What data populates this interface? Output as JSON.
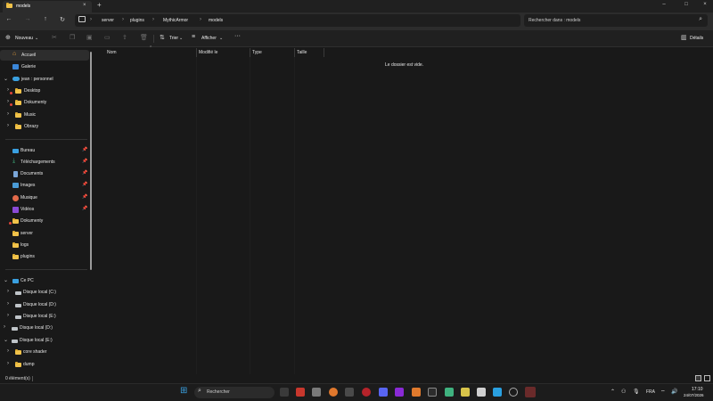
{
  "window": {
    "tab_title": "models",
    "new_tab": "+",
    "tab_close": "×",
    "minimize": "–",
    "maximize": "□",
    "close": "×"
  },
  "address": {
    "breadcrumbs": [
      "server",
      "plugins",
      "MythicArmor",
      "models"
    ],
    "search_placeholder": "Rechercher dans : models"
  },
  "toolbar": {
    "new_label": "Nouveau",
    "sort_label": "Trier",
    "view_label": "Afficher",
    "more_label": "···",
    "details_label": "Détails"
  },
  "sidebar": {
    "top": [
      {
        "label": "Accueil",
        "icon": "home-icon"
      },
      {
        "label": "Galerie",
        "icon": "gallery-icon"
      },
      {
        "label": "jean : personnel",
        "icon": "cloud-icon"
      },
      {
        "label": "Desktop",
        "icon": "folder-icon"
      },
      {
        "label": "Dokumenty",
        "icon": "folder-icon"
      },
      {
        "label": "Music",
        "icon": "folder-icon"
      },
      {
        "label": "Obrazy",
        "icon": "folder-icon"
      }
    ],
    "quick": [
      {
        "label": "Bureau",
        "icon": "desktop-icon"
      },
      {
        "label": "Téléchargements",
        "icon": "download-icon"
      },
      {
        "label": "Documents",
        "icon": "documents-icon"
      },
      {
        "label": "Images",
        "icon": "images-icon"
      },
      {
        "label": "Musique",
        "icon": "music-icon"
      },
      {
        "label": "Vidéos",
        "icon": "videos-icon"
      },
      {
        "label": "Dokumenty",
        "icon": "folder-icon"
      },
      {
        "label": "server",
        "icon": "folder-icon"
      },
      {
        "label": "logs",
        "icon": "folder-icon"
      },
      {
        "label": "plugins",
        "icon": "folder-icon"
      }
    ],
    "pc": [
      {
        "label": "Ce PC",
        "icon": "pc-icon"
      },
      {
        "label": "Disque local (C:)",
        "icon": "drive-icon"
      },
      {
        "label": "Disque local (D:)",
        "icon": "drive-icon"
      },
      {
        "label": "Disque local (E:)",
        "icon": "drive-icon"
      },
      {
        "label": "Disque local (D:)",
        "icon": "drive-icon"
      },
      {
        "label": "Disque local (E:)",
        "icon": "drive-icon"
      },
      {
        "label": "core shader",
        "icon": "folder-icon"
      },
      {
        "label": "dump",
        "icon": "folder-icon"
      }
    ]
  },
  "columns": [
    "Nom",
    "Modifié le",
    "Type",
    "Taille"
  ],
  "empty_message": "Le dossier est vide.",
  "status": {
    "count": "0 élément(s)"
  },
  "taskbar": {
    "search_label": "Rechercher",
    "lang": "FRA",
    "time": "17:10",
    "date": "24/07/2026"
  },
  "colors": {
    "accent": "#3aa0e0",
    "folder": "#f0c24a",
    "background": "#191919"
  }
}
